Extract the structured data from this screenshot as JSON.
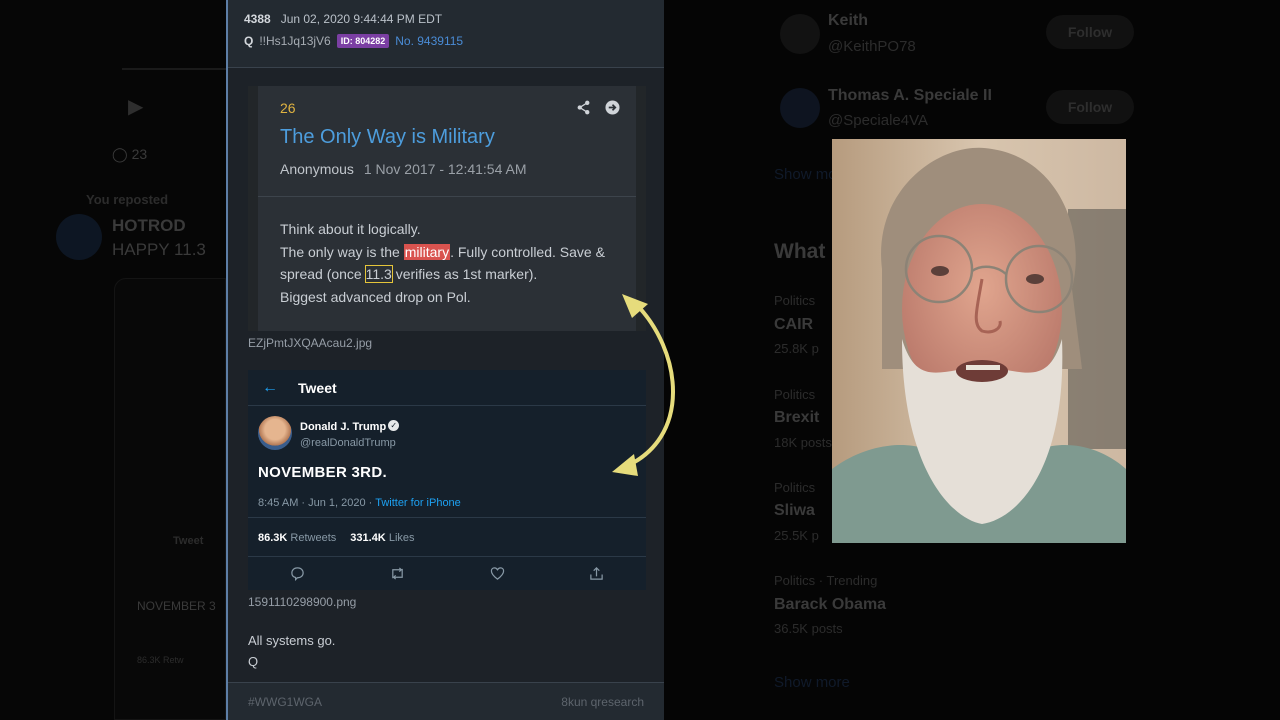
{
  "panel": {
    "post_number": "4388",
    "post_date": "Jun 02, 2020 9:44:44 PM EDT",
    "author": "Q",
    "tripcode": "!!Hs1Jq13jV6",
    "id_badge": "ID: 804282",
    "post_no": "No. 9439115",
    "quoted": {
      "number": "26",
      "title": "The Only Way is Military",
      "author": "Anonymous",
      "date": "1 Nov 2017 - 12:41:54 AM",
      "line1": "Think about it logically.",
      "line2_pre": "The only way is the ",
      "line2_hl": "military",
      "line2_post": ". Fully controlled. Save &",
      "line3_pre": "spread (once ",
      "line3_hl": "11.3",
      "line3_post": " verifies as 1st marker).",
      "line4": "Biggest advanced drop on Pol."
    },
    "image1_name": "EZjPmtJXQAAcau2.jpg",
    "tweet": {
      "header": "Tweet",
      "user_name": "Donald J. Trump",
      "handle": "@realDonaldTrump",
      "text": "NOVEMBER 3RD.",
      "time": "8:45 AM · Jun 1, 2020 · ",
      "source": "Twitter for iPhone",
      "retweets_count": "86.3K",
      "retweets_label": "Retweets",
      "likes_count": "331.4K",
      "likes_label": "Likes"
    },
    "image2_name": "1591110298900.png",
    "body_line1": "All systems go.",
    "body_line2": "Q",
    "footer_tag": "#WWG1WGA",
    "footer_source": "8kun qresearch"
  },
  "background_left": {
    "reply_count": "23",
    "reposted": "You reposted",
    "user": "HOTROD",
    "text": "HAPPY 11.3",
    "tweet_label": "Tweet",
    "tweet_text": "NOVEMBER 3",
    "stats": "86.3K Retw"
  },
  "background_right": {
    "follow1_name": "Keith",
    "follow1_handle": "@KeithPO78",
    "follow2_name": "Thomas A. Speciale II",
    "follow2_handle": "@Speciale4VA",
    "follow_label": "Follow",
    "show_more": "Show more",
    "whats": "What",
    "trends": [
      {
        "cat": "Politics",
        "name": "CAIR",
        "posts": "25.8K p"
      },
      {
        "cat": "Politics",
        "name": "Brexit",
        "posts": "18K posts"
      },
      {
        "cat": "Politics",
        "name": "Sliwa",
        "posts": "25.5K p"
      },
      {
        "cat": "Politics · Trending",
        "name": "Barack Obama",
        "posts": "36.5K posts"
      }
    ]
  },
  "colors": {
    "accent_blue": "#4d9ddd",
    "highlight_red": "#d9534f",
    "arrow_yellow": "#e6dc7c"
  }
}
